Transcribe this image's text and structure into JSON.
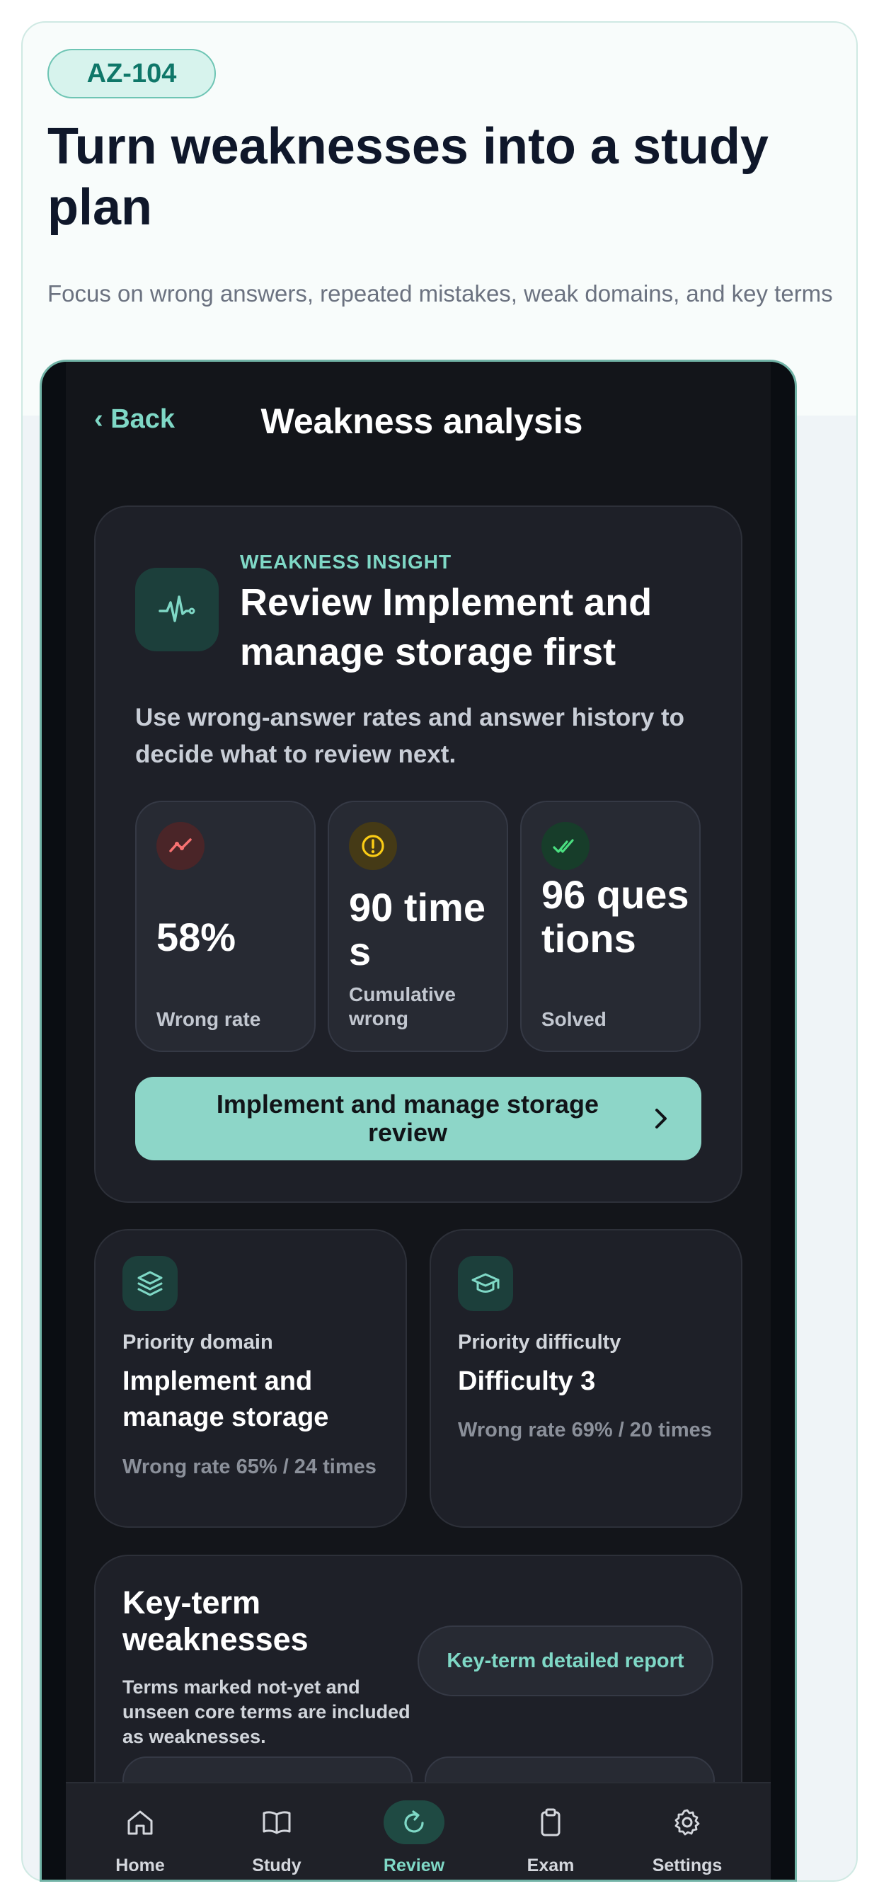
{
  "hero": {
    "tag": "AZ-104",
    "headline": "Turn weaknesses into a study plan",
    "subtext": "Focus on wrong answers, repeated mistakes, weak domains, and key terms"
  },
  "nav": {
    "back_label": "‹ Back",
    "title": "Weakness analysis"
  },
  "insight": {
    "eyebrow": "WEAKNESS INSIGHT",
    "title": "Review Implement and manage storage first",
    "description": "Use wrong-answer rates and answer history to decide what to review next.",
    "stats": [
      {
        "value": "58%",
        "label": "Wrong rate",
        "icon": "trend-icon",
        "color": "#f87171"
      },
      {
        "value": "90 times",
        "label": "Cumulative wrong",
        "icon": "alert-icon",
        "color": "#facc15"
      },
      {
        "value": "96 questions",
        "label": "Solved",
        "icon": "check-double-icon",
        "color": "#4ade80"
      }
    ],
    "cta_label": "Implement and manage storage review"
  },
  "priority_domain": {
    "label": "Priority domain",
    "title": "Implement and manage storage",
    "sub": "Wrong rate 65% / 24 times"
  },
  "priority_difficulty": {
    "label": "Priority difficulty",
    "title": "Difficulty 3",
    "sub": "Wrong rate 69% / 20 times"
  },
  "key_terms": {
    "title": "Key-term weaknesses",
    "description": "Terms marked not-yet and unseen core terms are included as weaknesses.",
    "button_label": "Key-term detailed report"
  },
  "tabs": [
    {
      "label": "Home",
      "icon": "home-icon"
    },
    {
      "label": "Study",
      "icon": "book-icon"
    },
    {
      "label": "Review",
      "icon": "refresh-icon",
      "active": true
    },
    {
      "label": "Exam",
      "icon": "clipboard-icon"
    },
    {
      "label": "Settings",
      "icon": "gear-icon"
    }
  ],
  "colors": {
    "accent": "#7fd8c6",
    "cta_background": "#8dd6c8",
    "screen_background": "#13151a",
    "card_background": "#1e2028"
  }
}
